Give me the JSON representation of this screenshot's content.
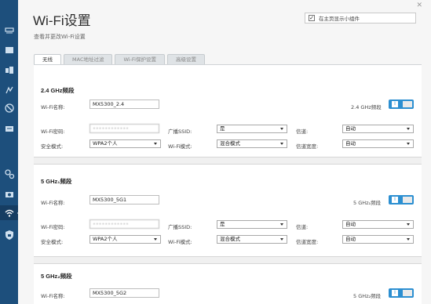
{
  "header": {
    "title": "Wi-Fi设置",
    "subtitle": "查看并更改Wi-Fi设置",
    "widget_checkbox_mark": "✓",
    "widget_checkbox_label": "在主页显示小组件",
    "close": "✕"
  },
  "tabs": [
    {
      "label": "无线"
    },
    {
      "label": "MAC地址过滤"
    },
    {
      "label": "Wi-Fi保护设置"
    },
    {
      "label": "高级设置"
    }
  ],
  "labels": {
    "wifi_name": "Wi-Fi名称:",
    "wifi_password": "Wi-Fi密码:",
    "security_mode": "安全模式:",
    "broadcast_ssid": "广播SSID:",
    "wifi_mode": "Wi-Fi模式:",
    "channel": "信道:",
    "channel_width": "信道宽度:"
  },
  "bands": [
    {
      "title": "2.4 GHz频段",
      "toggle_label": "2.4 GHz频段",
      "toggle_knob": "I",
      "wifi_name": "MX5300_2.4",
      "wifi_password": "••••••••••••",
      "broadcast_ssid": "是",
      "channel": "自动",
      "security_mode": "WPA2个人",
      "wifi_mode": "混合模式",
      "channel_width": "自动"
    },
    {
      "title": "5 GHz₁频段",
      "toggle_label": "5 GHz₁频段",
      "toggle_knob": "I",
      "wifi_name": "MX5300_5G1",
      "wifi_password": "••••••••••••",
      "broadcast_ssid": "是",
      "channel": "自动",
      "security_mode": "WPA2个人",
      "wifi_mode": "混合模式",
      "channel_width": "自动"
    },
    {
      "title": "5 GHz₂频段",
      "toggle_label": "5 GHz₂频段",
      "toggle_knob": "I",
      "wifi_name": "MX5300_5G2"
    }
  ],
  "colors": {
    "sidebar": "#1d4f7c",
    "toggle_on": "#2c8fd1"
  },
  "sidebar_icons": [
    "router-icon",
    "devices-icon",
    "parental-icon",
    "speed-icon",
    "media-icon",
    "settings-icon",
    "camera-icon",
    "wifi-icon",
    "security-icon"
  ]
}
